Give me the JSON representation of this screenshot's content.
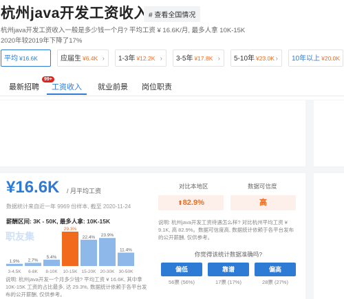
{
  "header": {
    "title": "杭州java开发工资收入",
    "nation_tag": "# 查看全国情况",
    "description": "杭州java开发工资收入一般是多少钱一个月? 平均工资 ¥ 16.6K/月, 最多人拿 10K-15K",
    "compare": "2020年较2019年下降了17%"
  },
  "filters": [
    {
      "label": "平均",
      "value": "¥16.6K",
      "active": true
    },
    {
      "label": "应届生",
      "value": "¥6.4K",
      "active": false
    },
    {
      "label": "1-3年",
      "value": "¥12.2K",
      "active": false
    },
    {
      "label": "3-5年",
      "value": "¥17.8K",
      "active": false
    },
    {
      "label": "5-10年",
      "value": "¥23.0K",
      "active": false
    },
    {
      "label": "10年以上",
      "value": "¥20.0K",
      "active": false
    }
  ],
  "tabs": [
    {
      "label": "最新招聘",
      "badge": "99+"
    },
    {
      "label": "工资收入"
    },
    {
      "label": "就业前景"
    },
    {
      "label": "岗位职责"
    }
  ],
  "salary": {
    "value": "¥16.6K",
    "unit": "/ 月平均工资",
    "meta": "数据统计来自近一年 9969 份样本, 截至 2020-11-24",
    "range": "薪酬区间: 3K - 50K, 最多人拿: 10K-15K",
    "watermark": "职友集",
    "note": "说明: 杭州java开发一个月多少钱? 平均工资 ¥ 16.6K, 其中拿 10K-15K 工资的占比最多, 达 29.3%, 数据统计依赖于各平台发布的公开薪酬, 仅供参考。"
  },
  "chart_data": {
    "type": "bar",
    "categories": [
      "3-4.5K",
      "6-8K",
      "8-10K",
      "10-15K",
      "15-20K",
      "20-30K",
      "30-50K"
    ],
    "values": [
      1.9,
      2.7,
      5.4,
      29.3,
      22.4,
      23.9,
      11.4
    ],
    "value_labels": [
      "1.9%",
      "2.7%",
      "5.4%",
      "29.3%",
      "22.4%",
      "23.9%",
      "11.4%"
    ],
    "highlight_index": 3,
    "colors": {
      "normal": "#8fb8ea",
      "highlight": "#f26b1d"
    }
  },
  "side": {
    "compare_label": "对比本地区",
    "compare_value": "82.9%",
    "compare_arrow": "⬆",
    "credibility_label": "数据可信度",
    "credibility_value": "高",
    "note": "说明: 杭州java开发工资待遇怎么样? 对比杭州平均工资 ¥ 9.1K, 高 82.9%。数据可信度高, 数据统计依赖于各平台发布的公开薪酬, 仅供参考。",
    "question": "你觉得该统计数据准确吗?",
    "votes": [
      {
        "label": "偏低",
        "count": "56票 (56%)"
      },
      {
        "label": "靠谱",
        "count": "17票 (17%)"
      },
      {
        "label": "偏高",
        "count": "28票 (27%)"
      }
    ]
  },
  "colors": {
    "accent": "#2e7bd6",
    "orange": "#f26b1d"
  }
}
